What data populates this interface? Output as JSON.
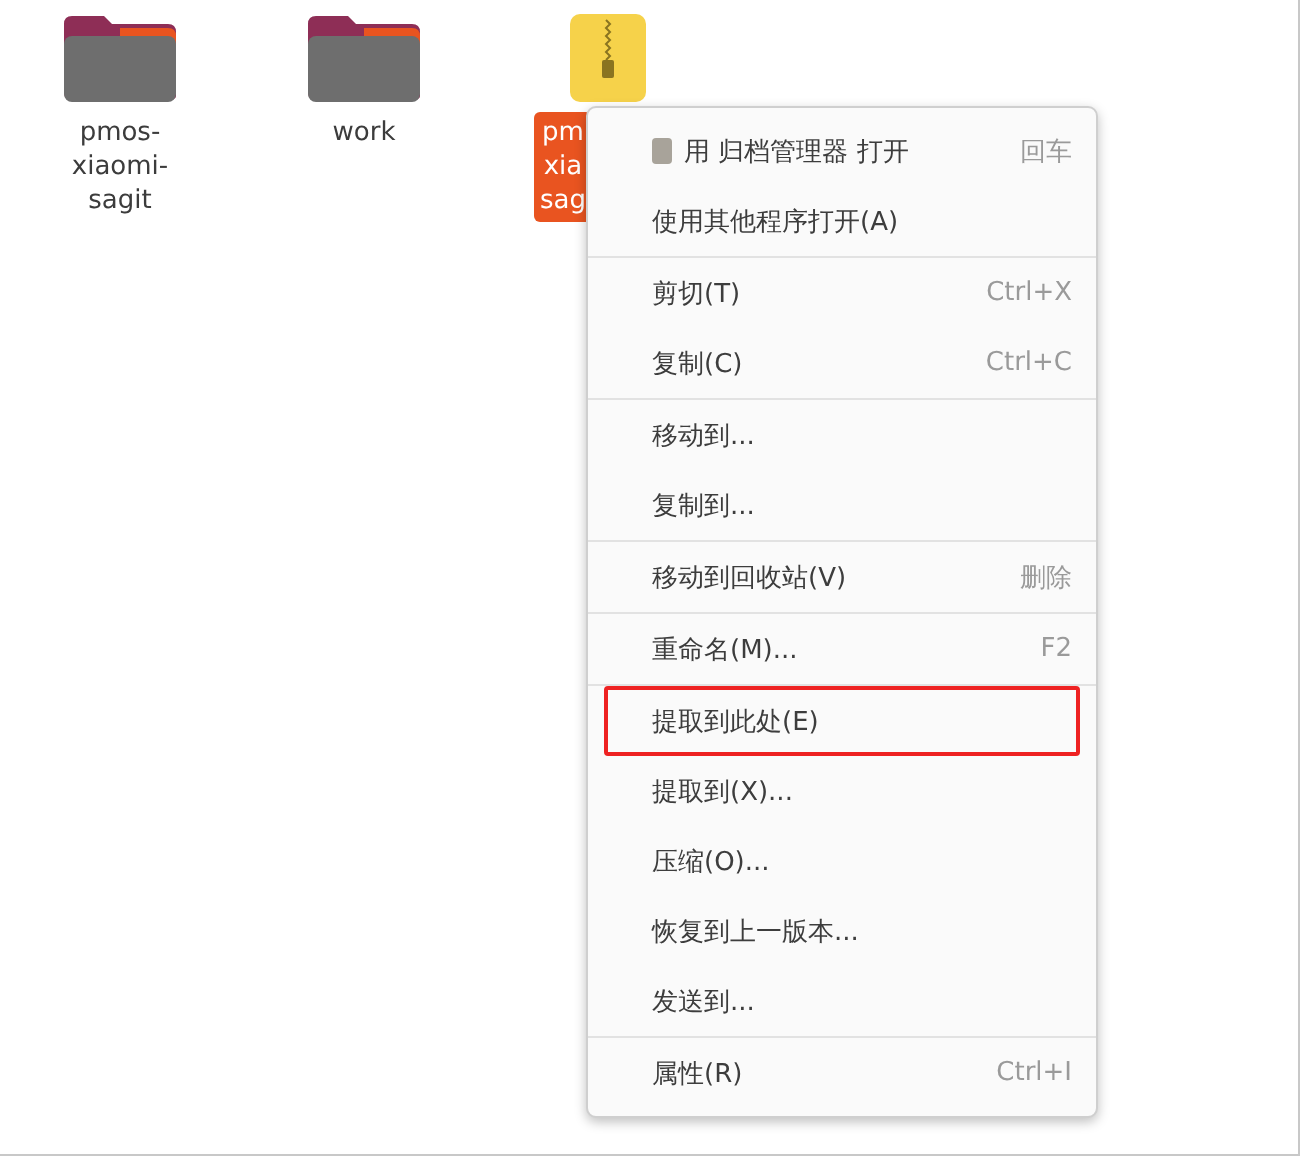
{
  "files": [
    {
      "kind": "folder",
      "label_lines": [
        "pmos-",
        "xiaomi-",
        "sagit"
      ],
      "selected": false
    },
    {
      "kind": "folder",
      "label_lines": [
        "work"
      ],
      "selected": false
    },
    {
      "kind": "archive",
      "label_lines": [
        "pm",
        "xia",
        "sag"
      ],
      "selected": true
    }
  ],
  "context_menu": {
    "groups": [
      [
        {
          "label": "用 归档管理器 打开",
          "shortcut": "回车",
          "has_icon": true,
          "highlighted": false
        },
        {
          "label": "使用其他程序打开(A)",
          "highlighted": false
        }
      ],
      [
        {
          "label": "剪切(T)",
          "shortcut": "Ctrl+X",
          "highlighted": false
        },
        {
          "label": "复制(C)",
          "shortcut": "Ctrl+C",
          "highlighted": false
        }
      ],
      [
        {
          "label": "移动到...",
          "highlighted": false
        },
        {
          "label": "复制到...",
          "highlighted": false
        }
      ],
      [
        {
          "label": "移动到回收站(V)",
          "shortcut": "删除",
          "highlighted": false
        }
      ],
      [
        {
          "label": "重命名(M)...",
          "shortcut": "F2",
          "highlighted": false
        }
      ],
      [
        {
          "label": "提取到此处(E)",
          "highlighted": true
        },
        {
          "label": "提取到(X)...",
          "highlighted": false
        },
        {
          "label": "压缩(O)...",
          "highlighted": false
        },
        {
          "label": "恢复到上一版本...",
          "highlighted": false
        },
        {
          "label": "发送到...",
          "highlighted": false
        }
      ],
      [
        {
          "label": "属性(R)",
          "shortcut": "Ctrl+I",
          "highlighted": false
        }
      ]
    ]
  }
}
